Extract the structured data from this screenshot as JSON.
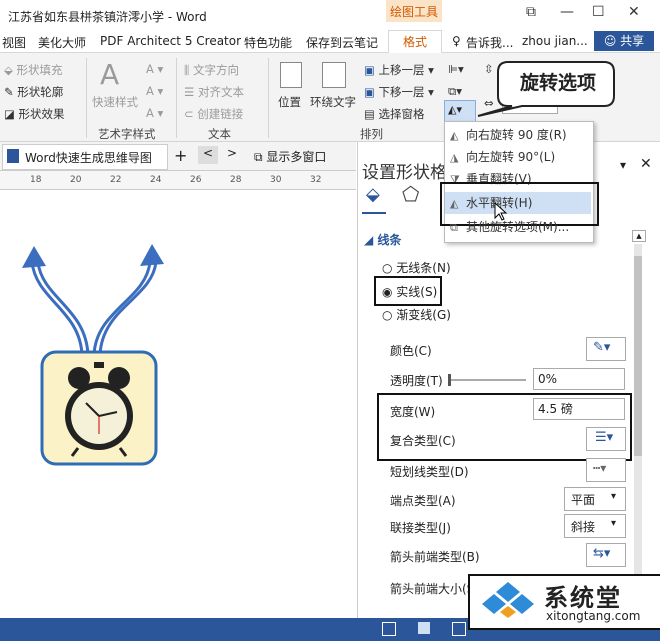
{
  "window": {
    "title": "江苏省如东县栟茶镇浒澪小学 - Word",
    "context_tab_group": "绘图工具",
    "min": "—",
    "max": "☐",
    "close": "✕",
    "restore": "⧉"
  },
  "tabs": [
    "视图",
    "美化大师",
    "PDF Architect 5 Creator",
    "特色功能",
    "保存到云笔记",
    "格式"
  ],
  "tell_me": "告诉我...",
  "user": "zhou jian...",
  "share": "共享",
  "ribbon": {
    "shape_fill": "形状填充",
    "shape_outline": "形状轮廓",
    "shape_effect": "形状效果",
    "quick_styles": "快速样式",
    "group_art": "艺术字样式",
    "text_direction": "文字方向",
    "align_text": "对齐文本",
    "create_link": "创建链接",
    "group_text": "文本",
    "position": "位置",
    "wrap_text": "环绕文字",
    "bring_forward": "上移一层",
    "send_backward": "下移一层",
    "selection_pane": "选择窗格",
    "group_arrange": "排列"
  },
  "callout": "旋转选项",
  "rotate_menu": {
    "items": [
      "向右旋转 90 度(R)",
      "向左旋转 90°(L)",
      "垂直翻转(V)",
      "水平翻转(H)",
      "其他旋转选项(M)..."
    ],
    "highlighted_index": 3
  },
  "doc_tab": {
    "name": "Word快速生成思维导图",
    "add": "+",
    "prev": "<",
    "next": ">",
    "multi_window": "显示多窗口"
  },
  "ruler_ticks": [
    "18",
    "20",
    "22",
    "24",
    "26",
    "28",
    "30",
    "32"
  ],
  "pane": {
    "title": "设置形状格式",
    "section": "线条",
    "radio_none": "无线条(N)",
    "radio_solid": "实线(S)",
    "radio_gradient": "渐变线(G)",
    "selected_radio": "solid",
    "color": "颜色(C)",
    "transparency": "透明度(T)",
    "transparency_value": "0%",
    "width": "宽度(W)",
    "width_value": "4.5 磅",
    "compound_type": "复合类型(C)",
    "dash_type": "短划线类型(D)",
    "cap_type": "端点类型(A)",
    "cap_value": "平面",
    "join_type": "联接类型(J)",
    "join_value": "斜接",
    "begin_arrow_type": "箭头前端类型(B)",
    "begin_arrow_size": "箭头前端大小(S)"
  },
  "watermark": {
    "brand": "系统堂",
    "url": "xitongtang.com"
  },
  "colors": {
    "accent": "#2b579a",
    "context": "#d05a00",
    "arrow": "#3c6ebf"
  }
}
